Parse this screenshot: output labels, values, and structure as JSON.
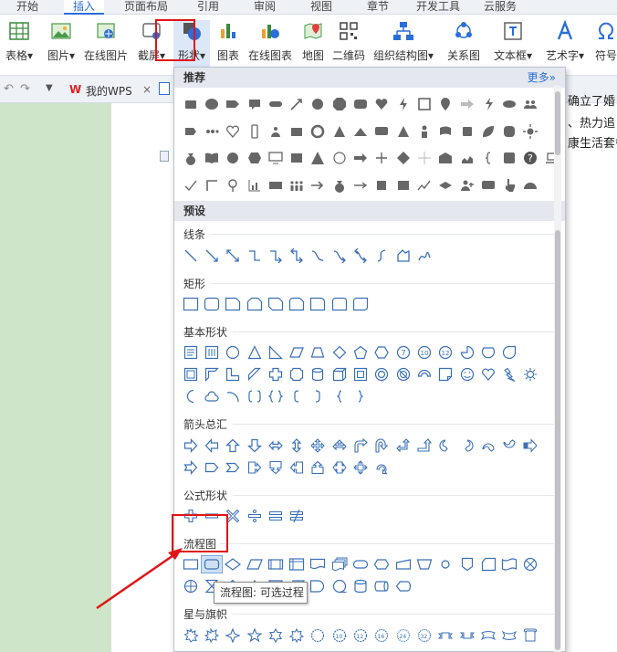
{
  "tabs": [
    "开始",
    "插入",
    "页面布局",
    "引用",
    "审阅",
    "视图",
    "章节",
    "开发工具",
    "云服务"
  ],
  "active_tab": "插入",
  "ribbon": {
    "table": "表格",
    "picture": "图片",
    "online_picture": "在线图片",
    "screenshot": "截屏",
    "shapes": "形状",
    "chart": "图表",
    "online_chart": "在线图表",
    "map": "地图",
    "qrcode": "二维码",
    "org_chart": "组织结构图",
    "relation_chart": "关系图",
    "textbox": "文本框",
    "wordart": "艺术字",
    "symbol": "符号"
  },
  "doc_tabs": {
    "my_wps": "我的WPS",
    "close": "×"
  },
  "doc_text": [
    "确立了婚",
    "、热力追",
    "康生活套餐"
  ],
  "panel": {
    "recommended": "推荐",
    "more": "更多»",
    "presets": "预设",
    "sections": {
      "lines": "线条",
      "rect": "矩形",
      "basic": "基本形状",
      "arrows": "箭头总汇",
      "equation": "公式形状",
      "flowchart": "流程图",
      "stars": "星与旗帜"
    }
  },
  "tooltip": "流程图: 可选过程",
  "colors": {
    "accent": "#2a6ed8",
    "shape_blue": "#3a70b8",
    "highlight": "#e01515",
    "doc_bg": "#cfe5c9"
  }
}
